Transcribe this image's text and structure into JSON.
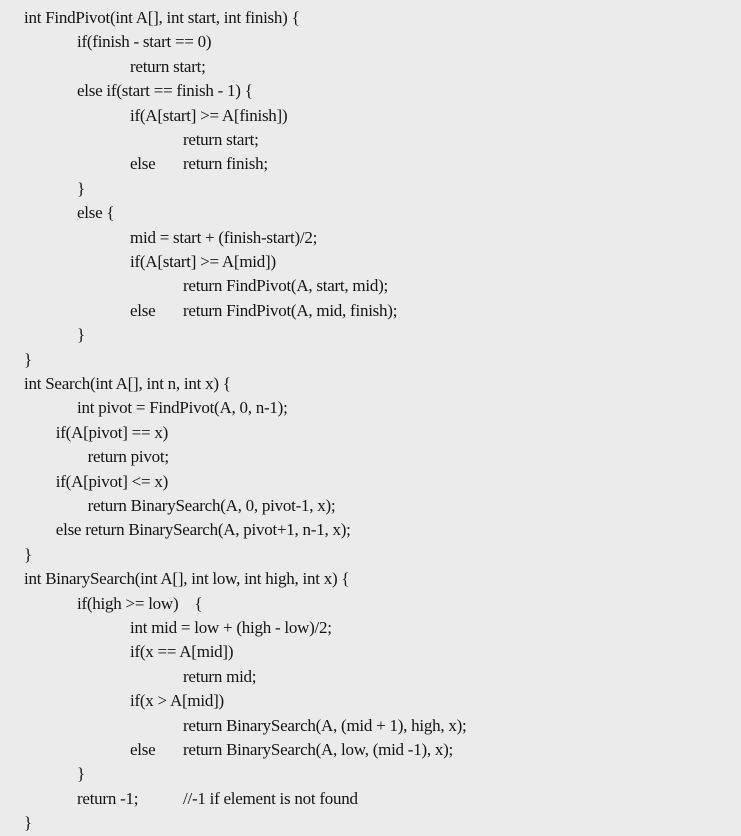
{
  "code": {
    "lines": [
      {
        "indent": 0,
        "text": "int FindPivot(int A[], int start, int finish) {"
      },
      {
        "indent": 1,
        "text": "if(finish - start == 0)"
      },
      {
        "indent": 2,
        "text": "return start;"
      },
      {
        "indent": 1,
        "text": "else if(start == finish - 1) {"
      },
      {
        "indent": 2,
        "text": "if(A[start] >= A[finish])"
      },
      {
        "indent": 3,
        "text": "return start;"
      },
      {
        "indent": 2,
        "text": "else",
        "tail_indent": 3,
        "tail": "return finish;"
      },
      {
        "indent": 1,
        "text": "}"
      },
      {
        "indent": 1,
        "text": "else {"
      },
      {
        "indent": 2,
        "text": "mid = start + (finish-start)/2;"
      },
      {
        "indent": 2,
        "text": "if(A[start] >= A[mid])"
      },
      {
        "indent": 3,
        "text": "return FindPivot(A, start, mid);"
      },
      {
        "indent": 2,
        "text": "else",
        "tail_indent": 3,
        "tail": "return FindPivot(A, mid, finish);"
      },
      {
        "indent": 1,
        "text": "}"
      },
      {
        "indent": 0,
        "text": "}"
      },
      {
        "indent": 0,
        "text": "int Search(int A[], int n, int x) {"
      },
      {
        "indent": 1,
        "text": "int pivot = FindPivot(A, 0, n-1);"
      },
      {
        "indent": 0.6,
        "text": "if(A[pivot] == x)"
      },
      {
        "indent": 1.2,
        "text": "return pivot;"
      },
      {
        "indent": 0.6,
        "text": "if(A[pivot] <= x)"
      },
      {
        "indent": 1.2,
        "text": "return BinarySearch(A, 0, pivot-1, x);"
      },
      {
        "indent": 0.6,
        "text": "else return BinarySearch(A, pivot+1, n-1, x);"
      },
      {
        "indent": 0,
        "text": "}"
      },
      {
        "indent": 0,
        "text": "int BinarySearch(int A[], int low, int high, int x) {"
      },
      {
        "indent": 1,
        "text": "if(high >= low)    {"
      },
      {
        "indent": 2,
        "text": "int mid = low + (high - low)/2;"
      },
      {
        "indent": 2,
        "text": "if(x == A[mid])"
      },
      {
        "indent": 3,
        "text": "return mid;"
      },
      {
        "indent": 2,
        "text": "if(x > A[mid])"
      },
      {
        "indent": 3,
        "text": "return BinarySearch(A, (mid + 1), high, x);"
      },
      {
        "indent": 2,
        "text": "else",
        "tail_indent": 3,
        "tail": "return BinarySearch(A, low, (mid -1), x);"
      },
      {
        "indent": 1,
        "text": "}"
      },
      {
        "indent": 1,
        "text": "return -1;",
        "tail_indent": 3,
        "tail": "//-1 if element is not found"
      },
      {
        "indent": 0,
        "text": "}"
      }
    ]
  }
}
